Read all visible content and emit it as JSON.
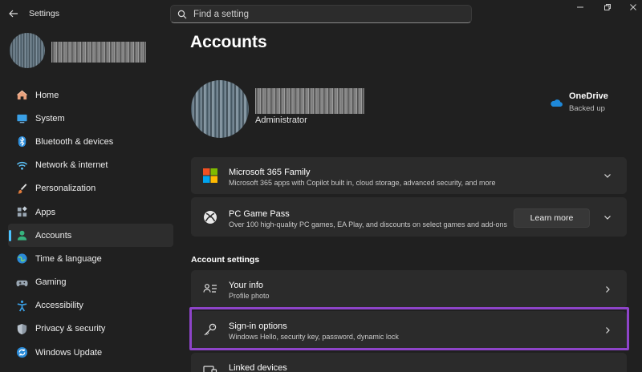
{
  "app": {
    "title": "Settings"
  },
  "search": {
    "placeholder": "Find a setting"
  },
  "nav": {
    "items": [
      {
        "label": "Home",
        "icon": "home-icon"
      },
      {
        "label": "System",
        "icon": "system-icon"
      },
      {
        "label": "Bluetooth & devices",
        "icon": "bluetooth-icon"
      },
      {
        "label": "Network & internet",
        "icon": "wifi-icon"
      },
      {
        "label": "Personalization",
        "icon": "brush-icon"
      },
      {
        "label": "Apps",
        "icon": "apps-icon"
      },
      {
        "label": "Accounts",
        "icon": "accounts-icon",
        "active": true
      },
      {
        "label": "Time & language",
        "icon": "globe-icon"
      },
      {
        "label": "Gaming",
        "icon": "gamepad-icon"
      },
      {
        "label": "Accessibility",
        "icon": "accessibility-icon"
      },
      {
        "label": "Privacy & security",
        "icon": "shield-icon"
      },
      {
        "label": "Windows Update",
        "icon": "update-icon"
      }
    ]
  },
  "main": {
    "title": "Accounts",
    "account": {
      "role": "Administrator"
    },
    "onedrive": {
      "title": "OneDrive",
      "status": "Backed up"
    },
    "cards": {
      "m365": {
        "title": "Microsoft 365 Family",
        "subtitle": "Microsoft 365 apps with Copilot built in, cloud storage, advanced security, and more"
      },
      "gamepass": {
        "title": "PC Game Pass",
        "subtitle": "Over 100 high-quality PC games, EA Play, and discounts on select games and add-ons",
        "button": "Learn more"
      }
    },
    "section_title": "Account settings",
    "settings": {
      "your_info": {
        "title": "Your info",
        "subtitle": "Profile photo"
      },
      "sign_in": {
        "title": "Sign-in options",
        "subtitle": "Windows Hello, security key, password, dynamic lock"
      },
      "linked": {
        "title": "Linked devices"
      }
    }
  },
  "colors": {
    "background": "#202020",
    "card": "#2b2b2b",
    "accent": "#4cc2ff",
    "highlight": "#8e44c9"
  }
}
